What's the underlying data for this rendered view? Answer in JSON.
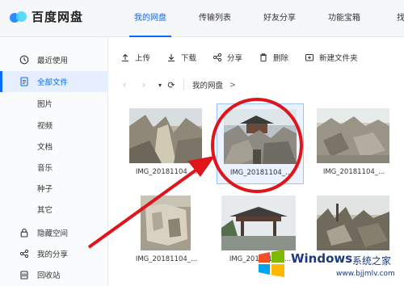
{
  "app": {
    "name": "百度网盘"
  },
  "nav": {
    "tabs": [
      "我的网盘",
      "传输列表",
      "好友分享",
      "功能宝箱",
      "找资源"
    ]
  },
  "sidebar": {
    "items": [
      {
        "label": "最近使用",
        "icon": "clock-icon"
      },
      {
        "label": "全部文件",
        "icon": "document-icon"
      },
      {
        "label": "图片"
      },
      {
        "label": "视频"
      },
      {
        "label": "文档"
      },
      {
        "label": "音乐"
      },
      {
        "label": "种子"
      },
      {
        "label": "其它"
      },
      {
        "label": "隐藏空间",
        "icon": "lock-icon"
      },
      {
        "label": "我的分享",
        "icon": "share-icon"
      },
      {
        "label": "回收站",
        "icon": "trash-icon"
      }
    ]
  },
  "toolbar": {
    "upload": "上传",
    "download": "下载",
    "share": "分享",
    "delete": "删除",
    "new_folder": "新建文件夹"
  },
  "breadcrumb": {
    "root": "我的网盘",
    "separator": ">"
  },
  "files": [
    {
      "name": "IMG_20181104_...",
      "selected": false
    },
    {
      "name": "IMG_20181104_...",
      "selected": true
    },
    {
      "name": "IMG_20181104_...",
      "selected": false
    },
    {
      "name": "IMG_20181104_...",
      "selected": false
    },
    {
      "name": "IMG_20181104_...",
      "selected": false
    },
    {
      "name": "",
      "selected": false
    }
  ],
  "colors": {
    "accent": "#0a69ff",
    "annotation": "#e0141b",
    "selected_bg": "#eaf3ff"
  },
  "watermark": {
    "brand": "Windows",
    "tagline": "系统之家",
    "url": "www.bjjmlv.com"
  }
}
